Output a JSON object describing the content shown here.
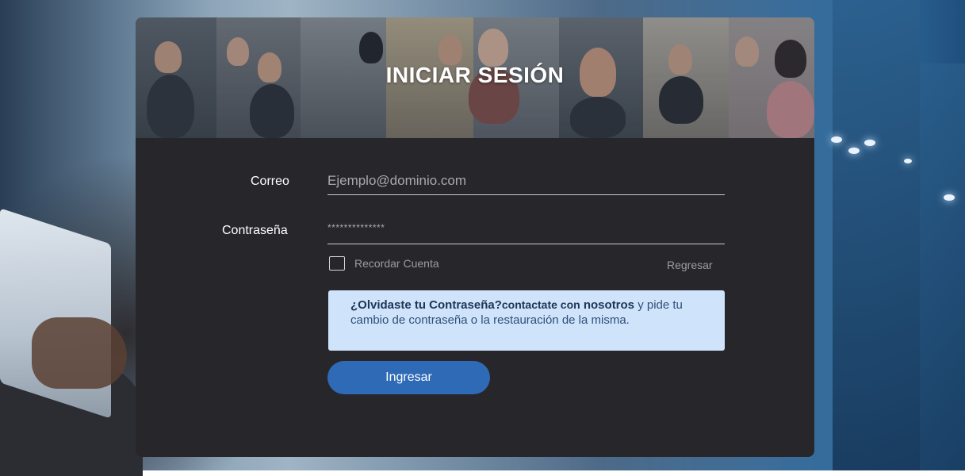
{
  "login": {
    "title": "INICIAR SESIÓN",
    "email_label": "Correo",
    "email_placeholder": "Ejemplo@dominio.com",
    "password_label": "Contraseña",
    "password_value": "**************",
    "remember_label": "Recordar Cuenta",
    "back_link": "Regresar",
    "notice": {
      "bold_question": "¿Olvidaste tu Contraseña?",
      "contact_prefix": "contactate con",
      "contact_bold": "nosotros",
      "rest": " y pide tu cambio de contraseña o la restauración de la misma."
    },
    "submit_label": "Ingresar"
  },
  "colors": {
    "card_bg": "#27272b",
    "button_bg": "#2f6ab7",
    "notice_bg": "#cfe4fb",
    "notice_text": "#2f4f7a"
  },
  "icons": [
    "checkbox-icon"
  ]
}
